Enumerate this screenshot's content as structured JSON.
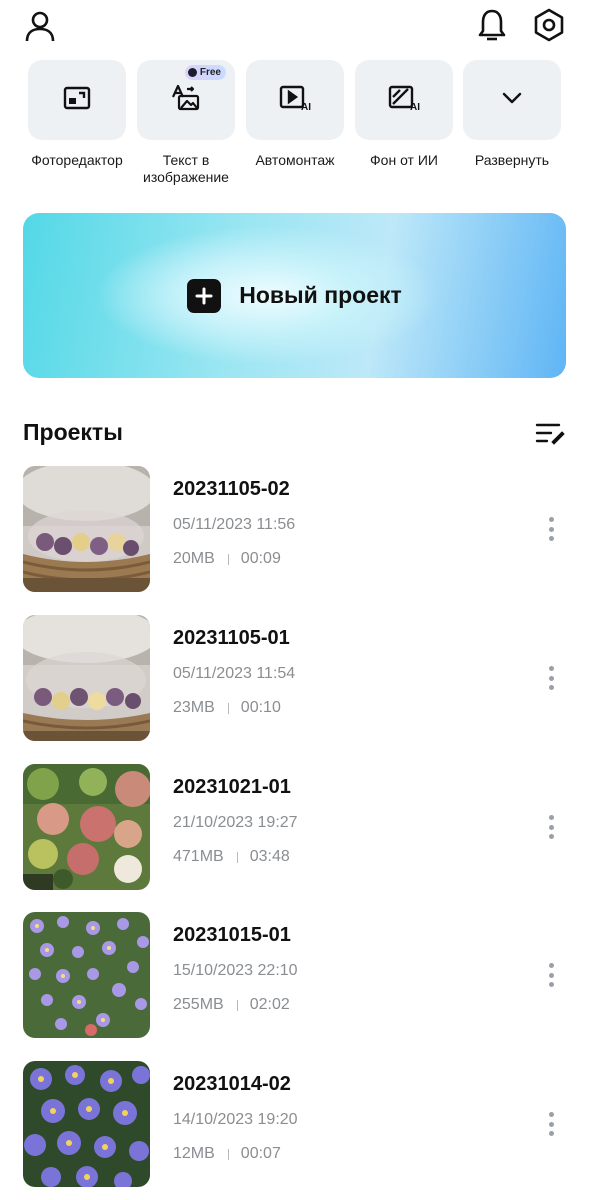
{
  "header": {
    "profile_icon": "person-icon",
    "bell_icon": "bell-icon",
    "settings_icon": "gear-icon"
  },
  "tools": [
    {
      "label": "Фоторедактор",
      "icon": "photo-edit-icon"
    },
    {
      "label": "Текст в изображение",
      "icon": "text-to-image-icon",
      "badge": "Free"
    },
    {
      "label": "Автомонтаж",
      "icon": "auto-edit-ai-icon"
    },
    {
      "label": "Фон от ИИ",
      "icon": "ai-background-icon"
    },
    {
      "label": "Развернуть",
      "icon": "chevron-down-icon"
    }
  ],
  "new_project": {
    "label": "Новый проект",
    "icon": "plus-icon"
  },
  "projects_section": {
    "title": "Проекты",
    "sort_icon": "sort-edit-icon"
  },
  "projects": [
    {
      "name": "20231105-02",
      "date": "05/11/2023 11:56",
      "size": "20MB",
      "duration": "00:09",
      "thumb": "sweets-basket"
    },
    {
      "name": "20231105-01",
      "date": "05/11/2023 11:54",
      "size": "23MB",
      "duration": "00:10",
      "thumb": "sweets-basket"
    },
    {
      "name": "20231021-01",
      "date": "21/10/2023 19:27",
      "size": "471MB",
      "duration": "03:48",
      "thumb": "hydrangea"
    },
    {
      "name": "20231015-01",
      "date": "15/10/2023 22:10",
      "size": "255MB",
      "duration": "02:02",
      "thumb": "asters"
    },
    {
      "name": "20231014-02",
      "date": "14/10/2023 19:20",
      "size": "12MB",
      "duration": "00:07",
      "thumb": "asters-close"
    }
  ],
  "colors": {
    "accent": "#111111",
    "muted_text": "#8a8d91",
    "tile_bg": "#eef1f4"
  }
}
